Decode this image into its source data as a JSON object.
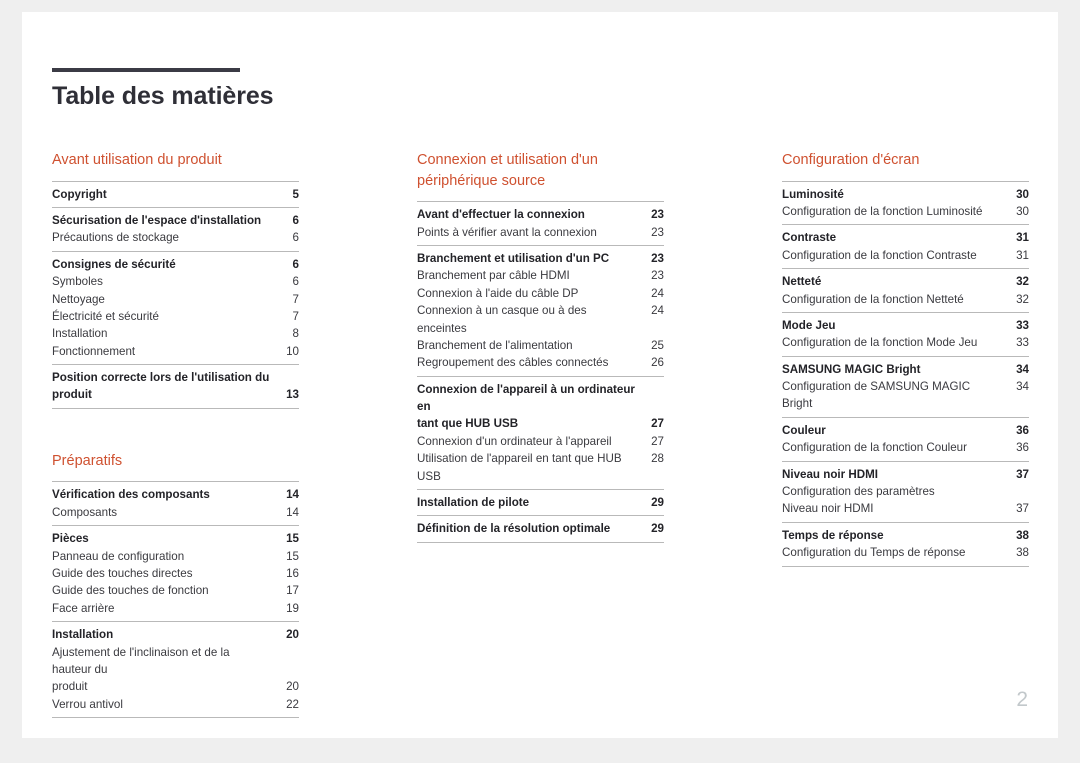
{
  "document": {
    "title": "Table des matières",
    "folio": "2",
    "accent_color": "#cf5130",
    "rule_color": "#3b3b45"
  },
  "columns": [
    {
      "name": "column-1",
      "groups": [
        {
          "title": "Avant utilisation du produit",
          "entries": [
            {
              "rows": [
                {
                  "type": "main",
                  "label": "Copyright",
                  "page": "5"
                }
              ]
            },
            {
              "rows": [
                {
                  "type": "main",
                  "label": "Sécurisation de l'espace d'installation",
                  "page": "6"
                },
                {
                  "type": "sub",
                  "label": "Précautions de stockage",
                  "page": "6"
                }
              ]
            },
            {
              "rows": [
                {
                  "type": "main",
                  "label": "Consignes de sécurité",
                  "page": "6"
                },
                {
                  "type": "sub",
                  "label": "Symboles",
                  "page": "6"
                },
                {
                  "type": "sub",
                  "label": "Nettoyage",
                  "page": "7"
                },
                {
                  "type": "sub",
                  "label": "Électricité et sécurité",
                  "page": "7"
                },
                {
                  "type": "sub",
                  "label": "Installation",
                  "page": "8"
                },
                {
                  "type": "sub",
                  "label": "Fonctionnement",
                  "page": "10"
                }
              ]
            },
            {
              "rows": [
                {
                  "type": "main",
                  "label": "Position correcte lors de l'utilisation du",
                  "page": ""
                },
                {
                  "type": "main",
                  "label": "produit",
                  "page": "13"
                }
              ]
            }
          ]
        },
        {
          "title": "Préparatifs",
          "entries": [
            {
              "rows": [
                {
                  "type": "main",
                  "label": "Vérification des composants",
                  "page": "14"
                },
                {
                  "type": "sub",
                  "label": "Composants",
                  "page": "14"
                }
              ]
            },
            {
              "rows": [
                {
                  "type": "main",
                  "label": "Pièces",
                  "page": "15"
                },
                {
                  "type": "sub",
                  "label": "Panneau de configuration",
                  "page": "15"
                },
                {
                  "type": "sub",
                  "label": "Guide des touches directes",
                  "page": "16"
                },
                {
                  "type": "sub",
                  "label": "Guide des touches de fonction",
                  "page": "17"
                },
                {
                  "type": "sub",
                  "label": "Face arrière",
                  "page": "19"
                }
              ]
            },
            {
              "rows": [
                {
                  "type": "main",
                  "label": "Installation",
                  "page": "20"
                },
                {
                  "type": "sub",
                  "label": "Ajustement de l'inclinaison et de la hauteur du",
                  "page": ""
                },
                {
                  "type": "sub",
                  "label": "produit",
                  "page": "20"
                },
                {
                  "type": "sub",
                  "label": "Verrou antivol",
                  "page": "22"
                }
              ]
            }
          ]
        }
      ]
    },
    {
      "name": "column-2",
      "groups": [
        {
          "title": "Connexion et utilisation d'un périphérique source",
          "entries": [
            {
              "rows": [
                {
                  "type": "main",
                  "label": "Avant d'effectuer la connexion",
                  "page": "23"
                },
                {
                  "type": "sub",
                  "label": "Points à vérifier avant la connexion",
                  "page": "23"
                }
              ]
            },
            {
              "rows": [
                {
                  "type": "main",
                  "label": "Branchement et utilisation d'un PC",
                  "page": "23"
                },
                {
                  "type": "sub",
                  "label": "Branchement par câble HDMI",
                  "page": "23"
                },
                {
                  "type": "sub",
                  "label": "Connexion à l'aide du câble DP",
                  "page": "24"
                },
                {
                  "type": "sub",
                  "label": "Connexion à un casque ou à des enceintes",
                  "page": "24"
                },
                {
                  "type": "sub",
                  "label": "Branchement de l'alimentation",
                  "page": "25"
                },
                {
                  "type": "sub",
                  "label": "Regroupement des câbles connectés",
                  "page": "26"
                }
              ]
            },
            {
              "rows": [
                {
                  "type": "main",
                  "label": "Connexion de l'appareil à un ordinateur en",
                  "page": ""
                },
                {
                  "type": "main",
                  "label": "tant que HUB USB",
                  "page": "27"
                },
                {
                  "type": "sub",
                  "label": "Connexion d'un ordinateur à l'appareil",
                  "page": "27"
                },
                {
                  "type": "sub",
                  "label": "Utilisation de l'appareil en tant que HUB USB",
                  "page": "28"
                }
              ]
            },
            {
              "rows": [
                {
                  "type": "main",
                  "label": "Installation de pilote",
                  "page": "29"
                }
              ]
            },
            {
              "rows": [
                {
                  "type": "main",
                  "label": "Définition de la résolution optimale",
                  "page": "29"
                }
              ]
            }
          ]
        }
      ]
    },
    {
      "name": "column-3",
      "groups": [
        {
          "title": "Configuration d'écran",
          "entries": [
            {
              "rows": [
                {
                  "type": "main",
                  "label": "Luminosité",
                  "page": "30"
                },
                {
                  "type": "sub",
                  "label": "Configuration de la fonction Luminosité",
                  "page": "30"
                }
              ]
            },
            {
              "rows": [
                {
                  "type": "main",
                  "label": "Contraste",
                  "page": "31"
                },
                {
                  "type": "sub",
                  "label": "Configuration de la fonction Contraste",
                  "page": "31"
                }
              ]
            },
            {
              "rows": [
                {
                  "type": "main",
                  "label": "Netteté",
                  "page": "32"
                },
                {
                  "type": "sub",
                  "label": "Configuration de la fonction Netteté",
                  "page": "32"
                }
              ]
            },
            {
              "rows": [
                {
                  "type": "main",
                  "label": "Mode Jeu",
                  "page": "33"
                },
                {
                  "type": "sub",
                  "label": "Configuration de la fonction Mode Jeu",
                  "page": "33"
                }
              ]
            },
            {
              "rows": [
                {
                  "type": "main",
                  "label": "SAMSUNG MAGIC Bright",
                  "page": "34"
                },
                {
                  "type": "sub",
                  "label": "Configuration de SAMSUNG MAGIC Bright",
                  "page": "34"
                }
              ]
            },
            {
              "rows": [
                {
                  "type": "main",
                  "label": "Couleur",
                  "page": "36"
                },
                {
                  "type": "sub",
                  "label": "Configuration de la fonction Couleur",
                  "page": "36"
                }
              ]
            },
            {
              "rows": [
                {
                  "type": "main",
                  "label": "Niveau noir HDMI",
                  "page": "37"
                },
                {
                  "type": "sub",
                  "label": "Configuration des paramètres",
                  "page": ""
                },
                {
                  "type": "sub",
                  "label": "Niveau noir HDMI",
                  "page": "37"
                }
              ]
            },
            {
              "rows": [
                {
                  "type": "main",
                  "label": "Temps de réponse",
                  "page": "38"
                },
                {
                  "type": "sub",
                  "label": "Configuration du Temps de réponse",
                  "page": "38"
                }
              ]
            }
          ]
        }
      ]
    }
  ]
}
